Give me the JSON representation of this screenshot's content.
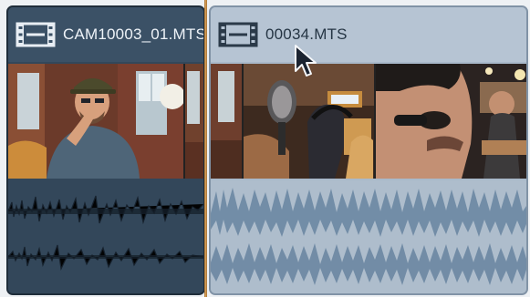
{
  "timeline": {
    "clips": [
      {
        "title": "CAM10003_01.MTS",
        "icon": "film-strip-icon",
        "selected": true,
        "color": "#33475a"
      },
      {
        "title": "00034.MTS",
        "icon": "film-strip-icon",
        "selected": false,
        "color": "#a9b9ca"
      }
    ],
    "playhead_color": "#e0a45a",
    "cursor": "arrow-pointer-icon"
  }
}
